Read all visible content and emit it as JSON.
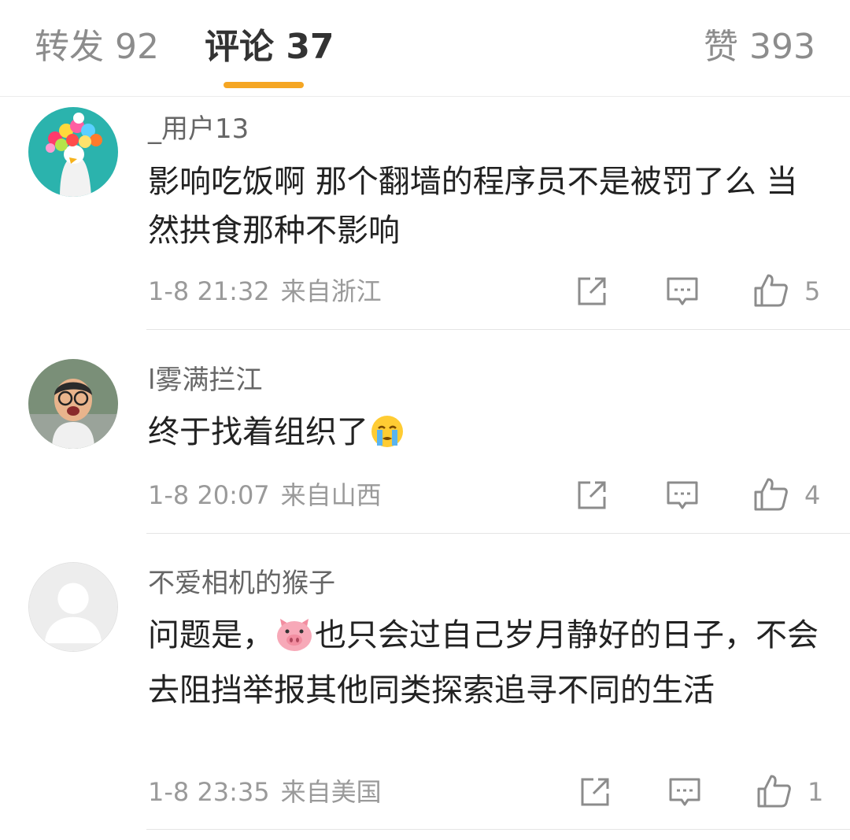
{
  "tabs": {
    "repost": "转发 92",
    "comments": "评论 37",
    "likes": "赞 393"
  },
  "colors": {
    "accent": "#f5a623",
    "text_primary": "#222222",
    "text_secondary": "#9a9a9a"
  },
  "comments": [
    {
      "username": "_用户13",
      "text": "影响吃饭啊 那个翻墙的程序员不是被罚了么 当然拱食那种不影响",
      "time": "1-8 21:32",
      "region": "来自浙江",
      "likes": "5"
    },
    {
      "username": "l雾满拦江",
      "text_before_emoji": "终于找着组织了",
      "emoji": "crying-face-emoji",
      "time": "1-8 20:07",
      "region": "来自山西",
      "likes": "4"
    },
    {
      "username": "不爱相机的猴子",
      "text_before_emoji": "问题是，",
      "emoji": "pig-face-emoji",
      "text_after_emoji": "也只会过自己岁月静好的日子，不会去阻挡举报其他同类探索追寻不同的生活",
      "time": "1-8 23:35",
      "region": "来自美国",
      "likes": "1"
    }
  ],
  "icons": {
    "share": "share-icon",
    "reply": "comment-icon",
    "like": "thumbs-up-icon"
  }
}
